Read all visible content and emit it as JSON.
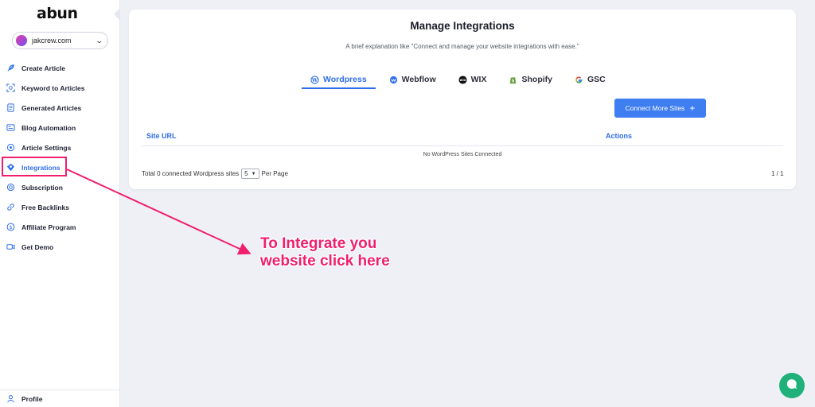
{
  "brand": {
    "logo": "abun"
  },
  "site_selector": {
    "value": "jakcrew.com"
  },
  "sidebar": {
    "items": [
      {
        "label": "Create Article",
        "icon": "feather-icon"
      },
      {
        "label": "Keyword to Articles",
        "icon": "scan-keyword-icon"
      },
      {
        "label": "Generated Articles",
        "icon": "document-icon"
      },
      {
        "label": "Blog Automation",
        "icon": "automation-icon"
      },
      {
        "label": "Article Settings",
        "icon": "settings-shield-icon"
      },
      {
        "label": "Integrations",
        "icon": "integrations-icon",
        "active": true
      },
      {
        "label": "Subscription",
        "icon": "subscription-icon"
      },
      {
        "label": "Free Backlinks",
        "icon": "link-icon"
      },
      {
        "label": "Affiliate Program",
        "icon": "dollar-icon"
      },
      {
        "label": "Get Demo",
        "icon": "video-icon"
      }
    ],
    "profile_label": "Profile"
  },
  "main": {
    "title": "Manage Integrations",
    "subtitle": "A brief explanation like \"Connect and manage your website integrations with ease.\"",
    "tabs": [
      {
        "label": "Wordpress",
        "icon": "wordpress-icon",
        "active": true
      },
      {
        "label": "Webflow",
        "icon": "webflow-icon"
      },
      {
        "label": "WIX",
        "icon": "wix-icon"
      },
      {
        "label": "Shopify",
        "icon": "shopify-icon"
      },
      {
        "label": "GSC",
        "icon": "google-icon"
      }
    ],
    "connect_button": {
      "label": "Connect More Sites",
      "icon": "plus-icon"
    },
    "table": {
      "columns": [
        "Site URL",
        "Actions"
      ],
      "empty_message": "No WordPress Sites Connected"
    },
    "footer": {
      "total_text": "Total 0 connected Wordpress sites",
      "per_page_value": "5",
      "per_page_label": "Per Page",
      "page_indicator": "1 / 1"
    }
  },
  "annotation": {
    "line1": "To Integrate you",
    "line2": "website click here",
    "color": "#ef1f6e"
  },
  "colors": {
    "accent": "#2f6ee8",
    "button": "#3f7ef0",
    "chat": "#20b07a",
    "background": "#eef0f6"
  }
}
